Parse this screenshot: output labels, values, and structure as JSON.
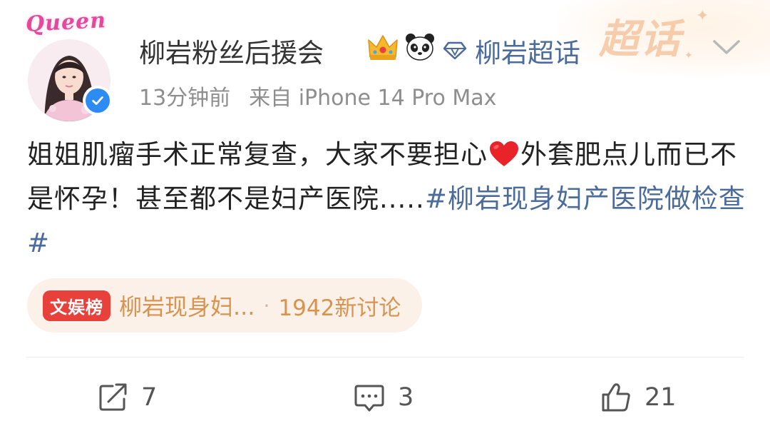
{
  "header": {
    "avatar_badge_text": "Queen",
    "username": "柳岩粉丝后援会",
    "super_topic_label": "柳岩超话",
    "super_topic_deco_text": "超话",
    "time_ago": "13分钟前",
    "source": "来自 iPhone 14 Pro Max"
  },
  "post": {
    "text_before_heart": "姐姐肌瘤手术正常复查，大家不要担心",
    "text_after_heart": "外套肥点儿而已不是怀孕！甚至都不是妇产医院.....",
    "hashtag": "#柳岩现身妇产医院做检查#"
  },
  "hot_topic": {
    "badge": "文娱榜",
    "title": "柳岩现身妇...",
    "separator": "·",
    "count": "1942新讨论"
  },
  "actions": {
    "repost_count": "7",
    "comment_count": "3",
    "like_count": "21"
  },
  "colors": {
    "link": "#4a6b9c",
    "hot_badge": "#e8413c",
    "hot_text": "#d8944f",
    "verified": "#2c8cf4"
  },
  "icons": {
    "crown": "crown-emoji-icon",
    "panda": "panda-emoji-icon",
    "diamond": "diamond-icon",
    "chevron": "chevron-down-icon",
    "repost": "repost-icon",
    "comment": "comment-icon",
    "like": "thumbs-up-icon",
    "heart": "red-heart-emoji-icon",
    "verified": "verified-check-icon"
  }
}
